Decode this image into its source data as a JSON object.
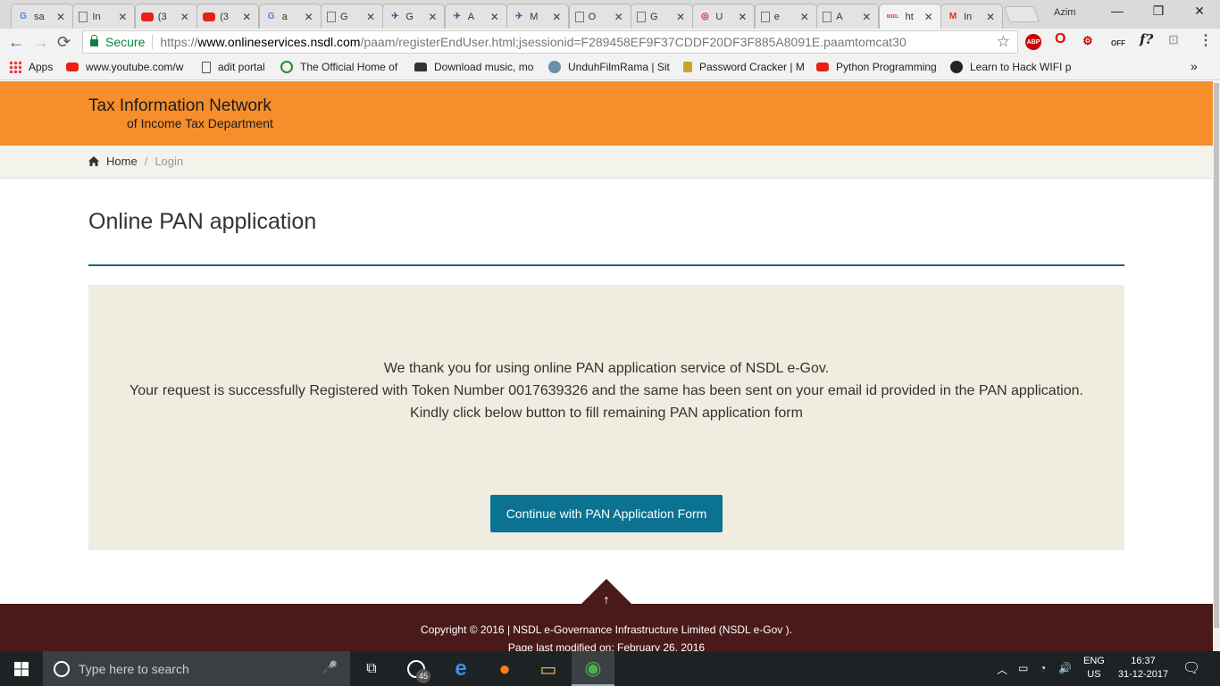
{
  "browser": {
    "tabs": [
      {
        "title": "sa",
        "icon": "G",
        "color": "#4285f4"
      },
      {
        "title": "In",
        "icon": "doc",
        "color": "#666"
      },
      {
        "title": "(3",
        "icon": "yt",
        "color": "#e62117"
      },
      {
        "title": "(3",
        "icon": "yt",
        "color": "#e62117"
      },
      {
        "title": "a",
        "icon": "G",
        "color": "#4285f4"
      },
      {
        "title": "G",
        "icon": "doc",
        "color": "#3c5a99"
      },
      {
        "title": "G",
        "icon": "plane",
        "color": "#3c5a99"
      },
      {
        "title": "A",
        "icon": "plane",
        "color": "#3c5a99"
      },
      {
        "title": "M",
        "icon": "plane",
        "color": "#3c5a99"
      },
      {
        "title": "O",
        "icon": "doc",
        "color": "#666"
      },
      {
        "title": "G",
        "icon": "doc",
        "color": "#666"
      },
      {
        "title": "U",
        "icon": "aadhaar",
        "color": "#d24"
      },
      {
        "title": "e",
        "icon": "doc",
        "color": "#666"
      },
      {
        "title": "A",
        "icon": "doc",
        "color": "#666"
      },
      {
        "title": "ht",
        "icon": "NSDL",
        "color": "#c33"
      },
      {
        "title": "In",
        "icon": "M",
        "color": "#d93025"
      }
    ],
    "active_tab_index": 14,
    "tab_close": "✕",
    "profile_name": "Azim",
    "window_minimize": "—",
    "window_restore": "❐",
    "window_close": "✕",
    "back": "←",
    "forward": "→",
    "reload": "⟳",
    "secure_label": "Secure",
    "url_scheme": "https://",
    "url_host": "www.onlineservices.nsdl.com",
    "url_path": "/paam/registerEndUser.html;jsessionid=F289458EF9F37CDDF20DF3F885A8091E.paamtomcat30",
    "star": "☆",
    "extensions": [
      "ABP",
      "O",
      "⚙",
      "OFF",
      "f?",
      "⊡",
      "⋮"
    ],
    "bookmarks": [
      {
        "label": "Apps",
        "icon": "apps-icon"
      },
      {
        "label": "www.youtube.com/w",
        "icon": "youtube-icon"
      },
      {
        "label": "adit portal",
        "icon": "page-icon"
      },
      {
        "label": "The Official Home of",
        "icon": "lions-icon"
      },
      {
        "label": "Download music, mo",
        "icon": "car-icon"
      },
      {
        "label": "UnduhFilmRama | Sit",
        "icon": "film-icon"
      },
      {
        "label": "Password Cracker | M",
        "icon": "lock-icon"
      },
      {
        "label": "Python Programming",
        "icon": "youtube-icon"
      },
      {
        "label": "Learn to Hack WIFI p",
        "icon": "hack-icon"
      }
    ],
    "bookmarks_more": "»"
  },
  "site": {
    "brand_line1": "Tax Information Network",
    "brand_line2": "of Income Tax Department",
    "breadcrumb_home": "Home",
    "breadcrumb_sep": "/",
    "breadcrumb_current": "Login",
    "page_title": "Online PAN application",
    "message_line1": "We thank you for using online PAN application service of NSDL e-Gov.",
    "message_line2": "Your request is successfully Registered with Token Number 0017639326 and the same has been sent on your email id provided in the PAN application.",
    "message_line3": "Kindly click below button to fill remaining PAN application form",
    "continue_button": "Continue with PAN Application Form",
    "back_to_top": "↑",
    "footer_copyright": "Copyright © 2016 | NSDL e-Governance Infrastructure Limited (NSDL e-Gov ).",
    "footer_modified": "Page last modified on: February 26, 2016",
    "colors": {
      "header": "#f68e2c",
      "button": "#0b7391",
      "panel": "#efeddf",
      "footer": "#4a1a1a",
      "rule": "#1d6579"
    }
  },
  "taskbar": {
    "search_placeholder": "Type here to search",
    "mic": "🎤",
    "taskview": "⧉",
    "badge": "45",
    "edge": "e",
    "firefox": "●",
    "explorer": "▭",
    "chrome": "◉",
    "tray_up": "︿",
    "tray_battery": "▭",
    "tray_network": "◔",
    "tray_volume": "🔊",
    "lang_top": "ENG",
    "lang_bottom": "US",
    "time": "16:37",
    "date": "31-12-2017",
    "notifications": "🗨"
  }
}
